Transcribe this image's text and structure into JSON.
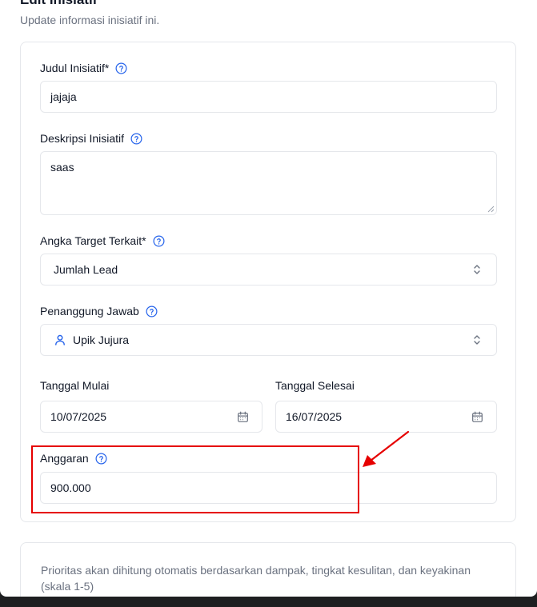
{
  "header": {
    "title": "Edit Inisiatif",
    "subtitle": "Update informasi inisiatif ini."
  },
  "form": {
    "judul": {
      "label": "Judul Inisiatif*",
      "value": "jajaja"
    },
    "deskripsi": {
      "label": "Deskripsi Inisiatif",
      "value": "saas"
    },
    "angka_target": {
      "label": "Angka Target Terkait*",
      "value": "Jumlah Lead"
    },
    "penanggung_jawab": {
      "label": "Penanggung Jawab",
      "value": "Upik Jujura"
    },
    "tanggal_mulai": {
      "label": "Tanggal Mulai",
      "value": "10/07/2025"
    },
    "tanggal_selesai": {
      "label": "Tanggal Selesai",
      "value": "16/07/2025"
    },
    "anggaran": {
      "label": "Anggaran",
      "value": "900.000"
    }
  },
  "priority_note": "Prioritas akan dihitung otomatis berdasarkan dampak, tingkat kesulitan, dan keyakinan (skala 1-5)",
  "icons": {
    "help": "help-circle-icon",
    "calendar": "calendar-icon",
    "user": "user-icon",
    "select": "chevron-up-down-icon"
  },
  "colors": {
    "accent": "#2563eb",
    "annotation": "#e60000",
    "border": "#e5e7eb",
    "muted_text": "#6b7280"
  }
}
